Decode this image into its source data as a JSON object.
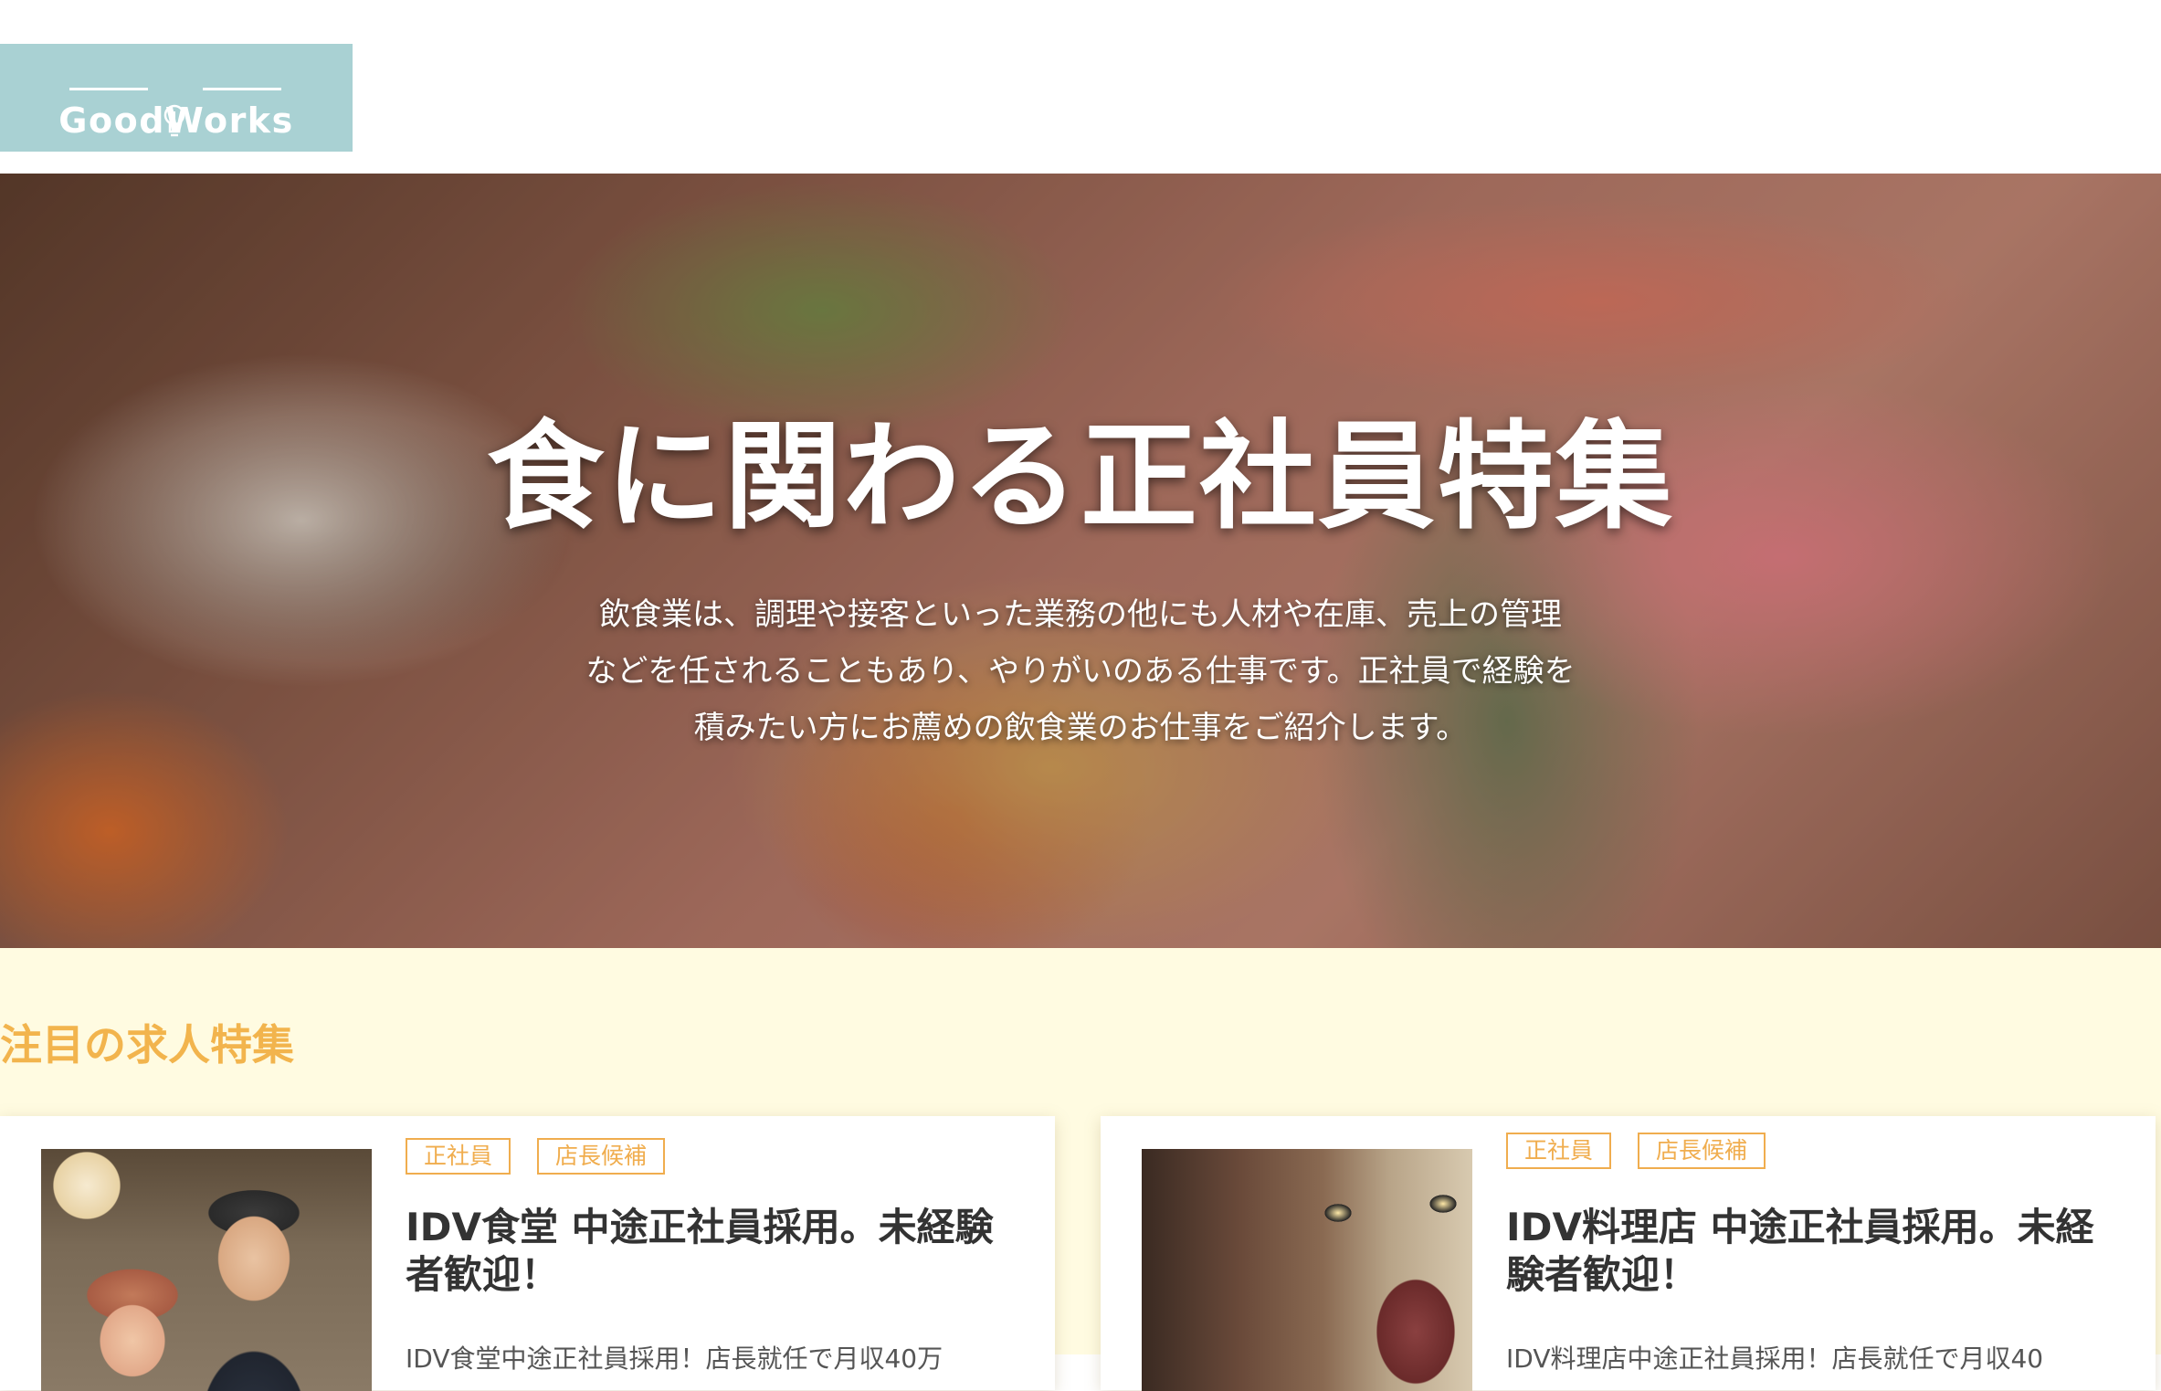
{
  "header": {
    "logo_text": "GoodWorks"
  },
  "hero": {
    "title": "食に関わる正社員特集",
    "description_lines": [
      "飲食業は、調理や接客といった業務の他にも人材や在庫、売上の管理",
      "などを任されることもあり、やりがいのある仕事です。正社員で経験を",
      "積みたい方にお薦めの飲食業のお仕事をご紹介します。"
    ]
  },
  "featured": {
    "heading": "注目の求人特集",
    "jobs": [
      {
        "tags": [
          "正社員",
          "店長候補"
        ],
        "title": "IDV食堂 中途正社員採用。未経験者歓迎！",
        "excerpt": "IDV食堂中途正社員採用！店長就任で月収40万"
      },
      {
        "tags": [
          "正社員",
          "店長候補"
        ],
        "title": "IDV料理店 中途正社員採用。未経験者歓迎！",
        "excerpt": "IDV料理店中途正社員採用！店長就任で月収40"
      }
    ]
  },
  "colors": {
    "logo_bg": "#a9d1d3",
    "accent": "#f0ad4e",
    "section_bg": "#fffbe1"
  }
}
